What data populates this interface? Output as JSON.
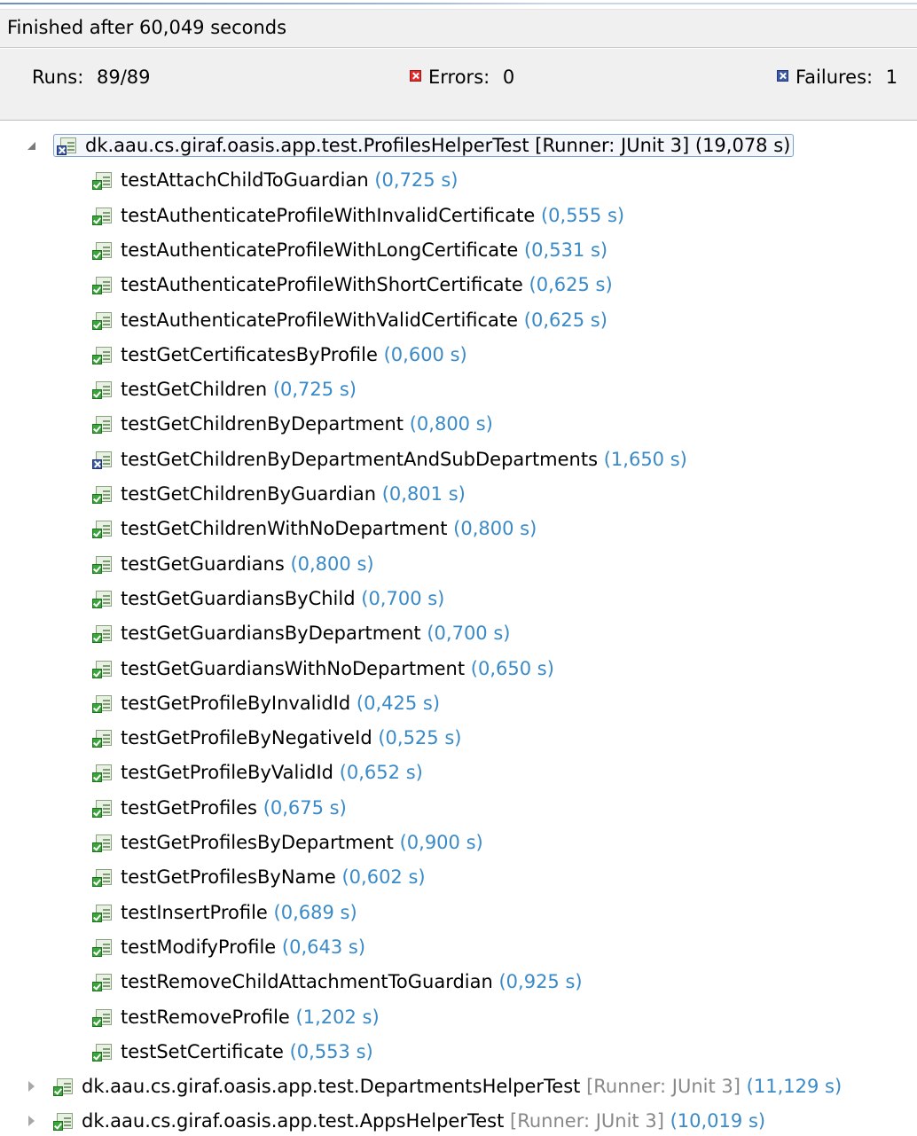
{
  "status_text": "Finished after 60,049 seconds",
  "counters": {
    "runs_label": "Runs:",
    "runs_value": "89/89",
    "errors_label": "Errors:",
    "errors_value": "0",
    "failures_label": "Failures:",
    "failures_value": "1"
  },
  "suite": {
    "name": "dk.aau.cs.giraf.oasis.app.test.ProfilesHelperTest",
    "runner": "[Runner: JUnit 3]",
    "time": "(19,078 s)",
    "status": "failed",
    "expanded": true
  },
  "tests": [
    {
      "name": "testAttachChildToGuardian",
      "time": "(0,725 s)",
      "status": "passed"
    },
    {
      "name": "testAuthenticateProfileWithInvalidCertificate",
      "time": "(0,555 s)",
      "status": "passed"
    },
    {
      "name": "testAuthenticateProfileWithLongCertificate",
      "time": "(0,531 s)",
      "status": "passed"
    },
    {
      "name": "testAuthenticateProfileWithShortCertificate",
      "time": "(0,625 s)",
      "status": "passed"
    },
    {
      "name": "testAuthenticateProfileWithValidCertificate",
      "time": "(0,625 s)",
      "status": "passed"
    },
    {
      "name": "testGetCertificatesByProfile",
      "time": "(0,600 s)",
      "status": "passed"
    },
    {
      "name": "testGetChildren",
      "time": "(0,725 s)",
      "status": "passed"
    },
    {
      "name": "testGetChildrenByDepartment",
      "time": "(0,800 s)",
      "status": "passed"
    },
    {
      "name": "testGetChildrenByDepartmentAndSubDepartments",
      "time": "(1,650 s)",
      "status": "failed"
    },
    {
      "name": "testGetChildrenByGuardian",
      "time": "(0,801 s)",
      "status": "passed"
    },
    {
      "name": "testGetChildrenWithNoDepartment",
      "time": "(0,800 s)",
      "status": "passed"
    },
    {
      "name": "testGetGuardians",
      "time": "(0,800 s)",
      "status": "passed"
    },
    {
      "name": "testGetGuardiansByChild",
      "time": "(0,700 s)",
      "status": "passed"
    },
    {
      "name": "testGetGuardiansByDepartment",
      "time": "(0,700 s)",
      "status": "passed"
    },
    {
      "name": "testGetGuardiansWithNoDepartment",
      "time": "(0,650 s)",
      "status": "passed"
    },
    {
      "name": "testGetProfileByInvalidId",
      "time": "(0,425 s)",
      "status": "passed"
    },
    {
      "name": "testGetProfileByNegativeId",
      "time": "(0,525 s)",
      "status": "passed"
    },
    {
      "name": "testGetProfileByValidId",
      "time": "(0,652 s)",
      "status": "passed"
    },
    {
      "name": "testGetProfiles",
      "time": "(0,675 s)",
      "status": "passed"
    },
    {
      "name": "testGetProfilesByDepartment",
      "time": "(0,900 s)",
      "status": "passed"
    },
    {
      "name": "testGetProfilesByName",
      "time": "(0,602 s)",
      "status": "passed"
    },
    {
      "name": "testInsertProfile",
      "time": "(0,689 s)",
      "status": "passed"
    },
    {
      "name": "testModifyProfile",
      "time": "(0,643 s)",
      "status": "passed"
    },
    {
      "name": "testRemoveChildAttachmentToGuardian",
      "time": "(0,925 s)",
      "status": "passed"
    },
    {
      "name": "testRemoveProfile",
      "time": "(1,202 s)",
      "status": "passed"
    },
    {
      "name": "testSetCertificate",
      "time": "(0,553 s)",
      "status": "passed"
    }
  ],
  "other_suites": [
    {
      "name": "dk.aau.cs.giraf.oasis.app.test.DepartmentsHelperTest",
      "runner": "[Runner: JUnit 3]",
      "time": "(11,129 s)",
      "status": "passed",
      "expanded": false
    },
    {
      "name": "dk.aau.cs.giraf.oasis.app.test.AppsHelperTest",
      "runner": "[Runner: JUnit 3]",
      "time": "(10,019 s)",
      "status": "passed",
      "expanded": false
    }
  ],
  "colors": {
    "duration": "#3a8ac8",
    "error_badge": "#e02c2c",
    "failure_badge": "#3d5aa6",
    "pass_badge": "#3aa53a"
  }
}
